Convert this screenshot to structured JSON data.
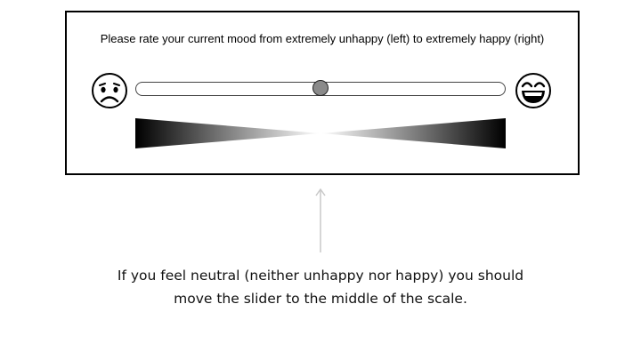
{
  "survey": {
    "prompt": "Please rate your current mood from extremely unhappy (left) to extremely happy (right)",
    "left_icon": "sad-face-icon",
    "right_icon": "happy-face-icon",
    "slider": {
      "min": 0,
      "max": 1,
      "value": 0.5
    }
  },
  "annotation": {
    "caption_line1": "If you feel neutral (neither unhappy nor happy) you should",
    "caption_line2": "move the slider to the middle of the scale."
  }
}
